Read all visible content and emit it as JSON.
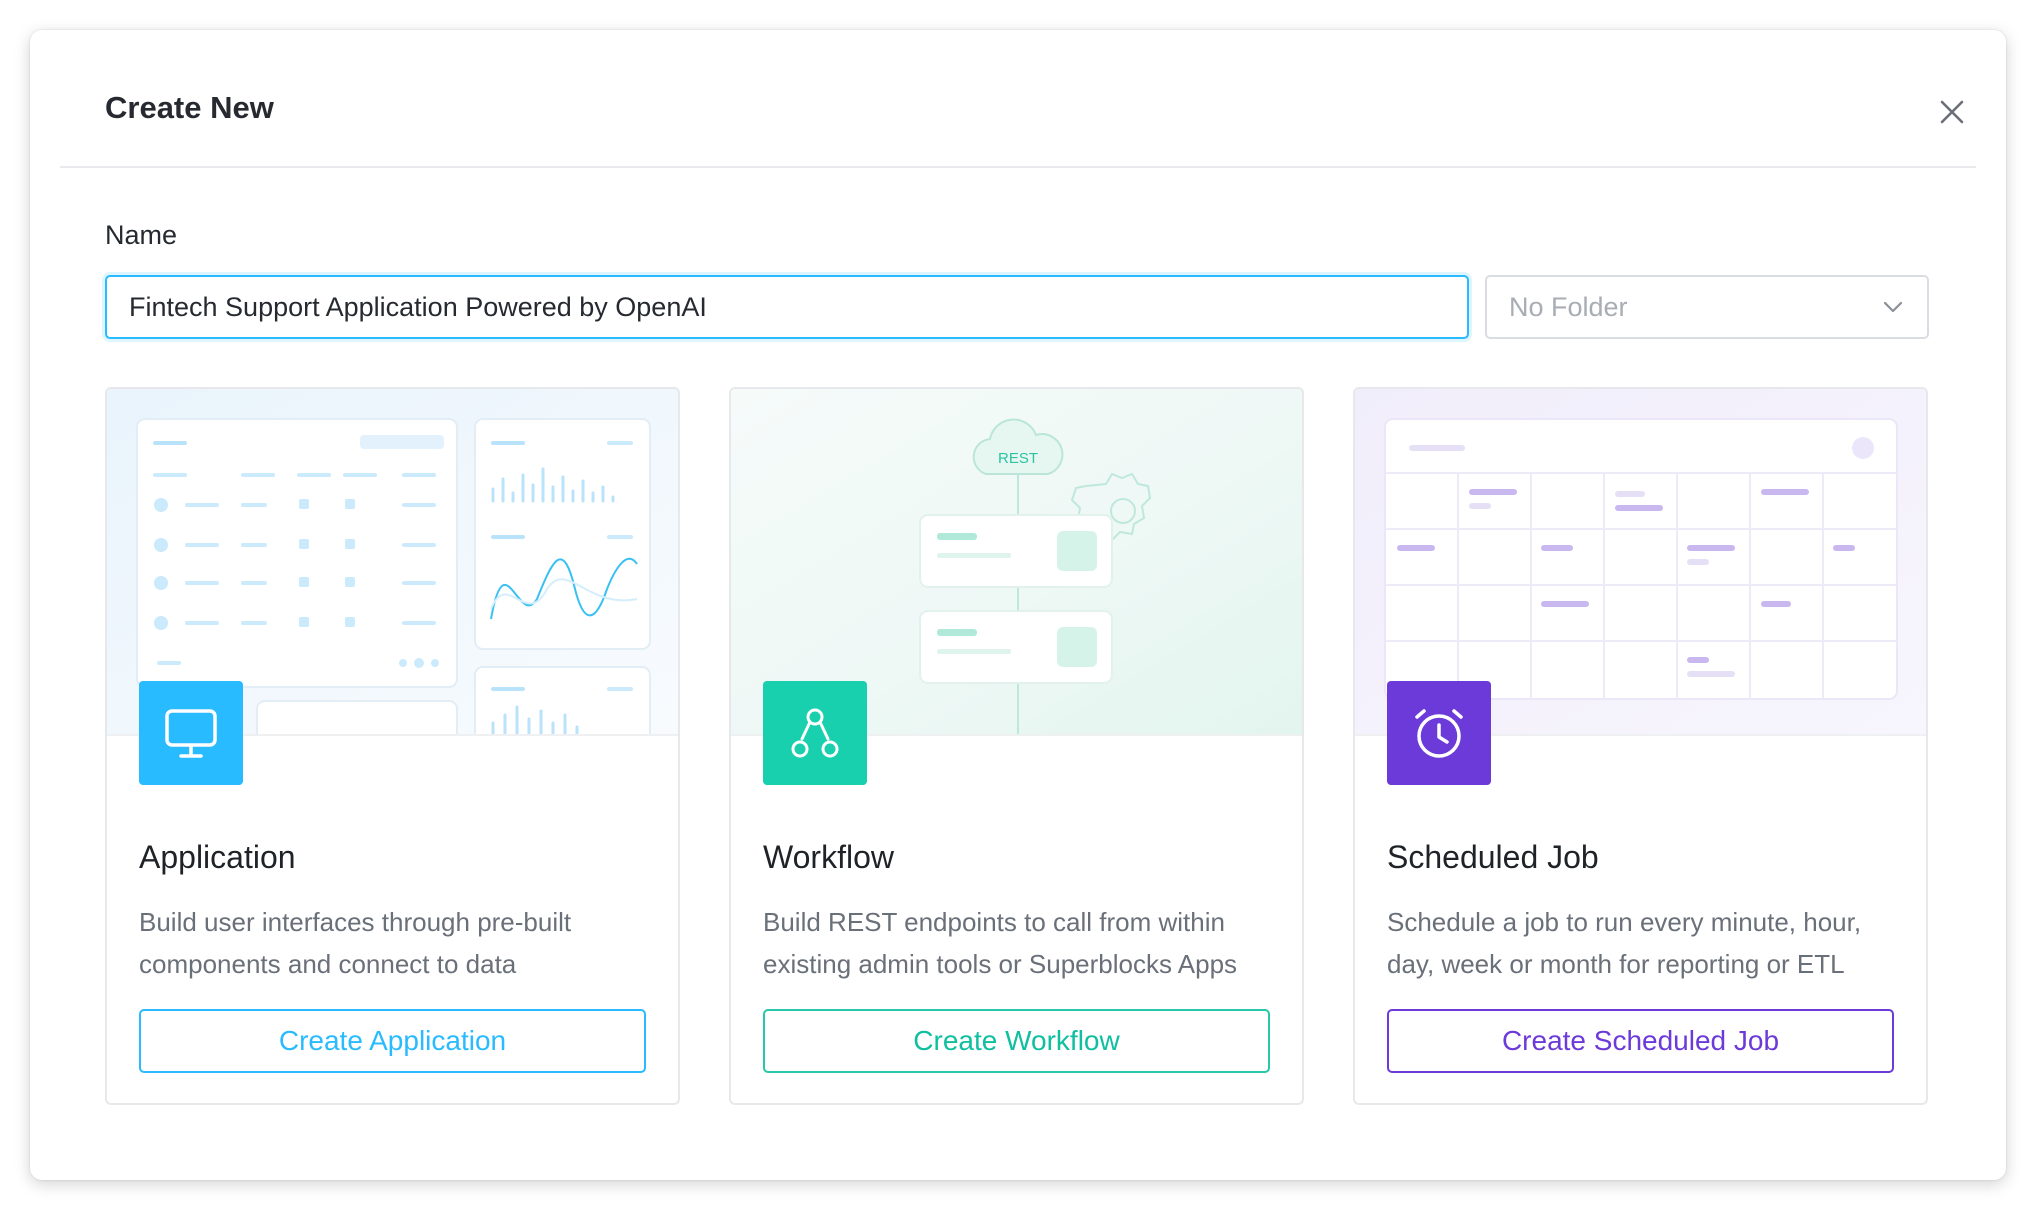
{
  "dialog": {
    "title": "Create New",
    "close_icon": "close-icon"
  },
  "form": {
    "name_label": "Name",
    "name_value": "Fintech Support Application Powered by OpenAI",
    "folder_placeholder": "No Folder",
    "folder_icon": "chevron-down-icon"
  },
  "cards": [
    {
      "title": "Application",
      "description": "Build user interfaces through pre-built components and connect to data",
      "button": "Create Application",
      "icon": "monitor-icon",
      "color": "#29bbff"
    },
    {
      "title": "Workflow",
      "description": "Build REST endpoints to call from within existing admin tools or Superblocks Apps",
      "button": "Create Workflow",
      "icon": "workflow-icon",
      "color": "#18cfae",
      "illustration_label": "REST"
    },
    {
      "title": "Scheduled Job",
      "description": "Schedule a job to run every minute, hour, day, week or month for reporting or ETL",
      "button": "Create Scheduled Job",
      "icon": "alarm-clock-icon",
      "color": "#6c3ad9"
    }
  ]
}
